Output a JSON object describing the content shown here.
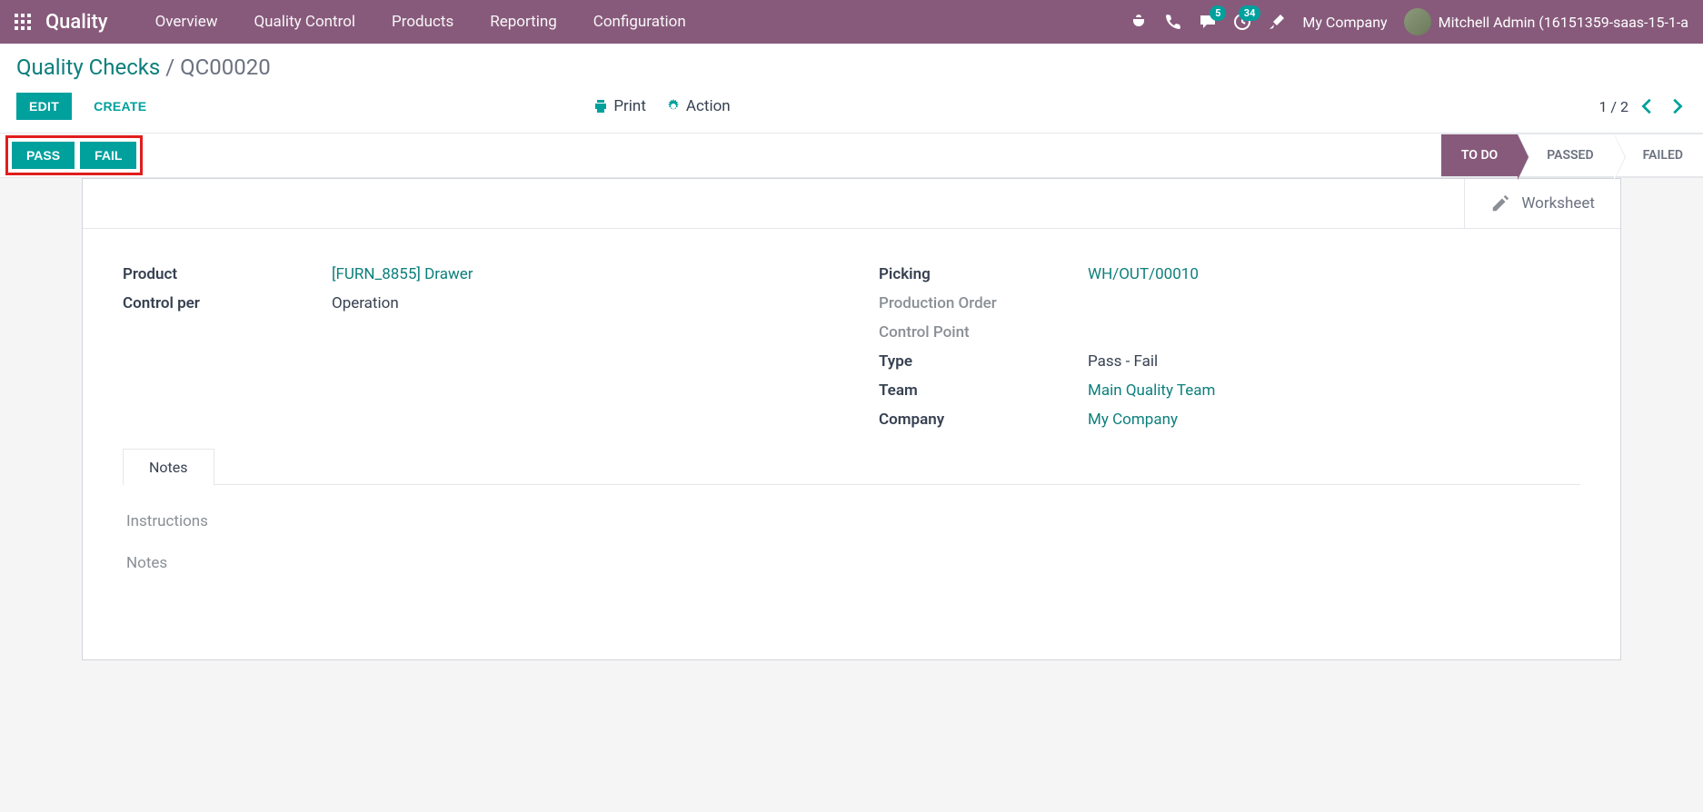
{
  "topbar": {
    "brand": "Quality",
    "nav": [
      "Overview",
      "Quality Control",
      "Products",
      "Reporting",
      "Configuration"
    ],
    "msg_count": "5",
    "activity_count": "34",
    "company": "My Company",
    "user": "Mitchell Admin (16151359-saas-15-1-a"
  },
  "breadcrumb": {
    "parent": "Quality Checks",
    "current": "QC00020"
  },
  "actions": {
    "edit": "Edit",
    "create": "Create",
    "print": "Print",
    "action": "Action"
  },
  "pager": "1 / 2",
  "pass_fail": {
    "pass": "Pass",
    "fail": "Fail"
  },
  "status": [
    "To Do",
    "Passed",
    "Failed"
  ],
  "worksheet": "Worksheet",
  "fields": {
    "left": {
      "product_label": "Product",
      "product_value": "[FURN_8855] Drawer",
      "control_per_label": "Control per",
      "control_per_value": "Operation"
    },
    "right": {
      "picking_label": "Picking",
      "picking_value": "WH/OUT/00010",
      "po_label": "Production Order",
      "cp_label": "Control Point",
      "type_label": "Type",
      "type_value": "Pass - Fail",
      "team_label": "Team",
      "team_value": "Main Quality Team",
      "company_label": "Company",
      "company_value": "My Company"
    }
  },
  "tabs": {
    "notes": "Notes"
  },
  "notes_section": {
    "instructions": "Instructions",
    "notes": "Notes"
  }
}
